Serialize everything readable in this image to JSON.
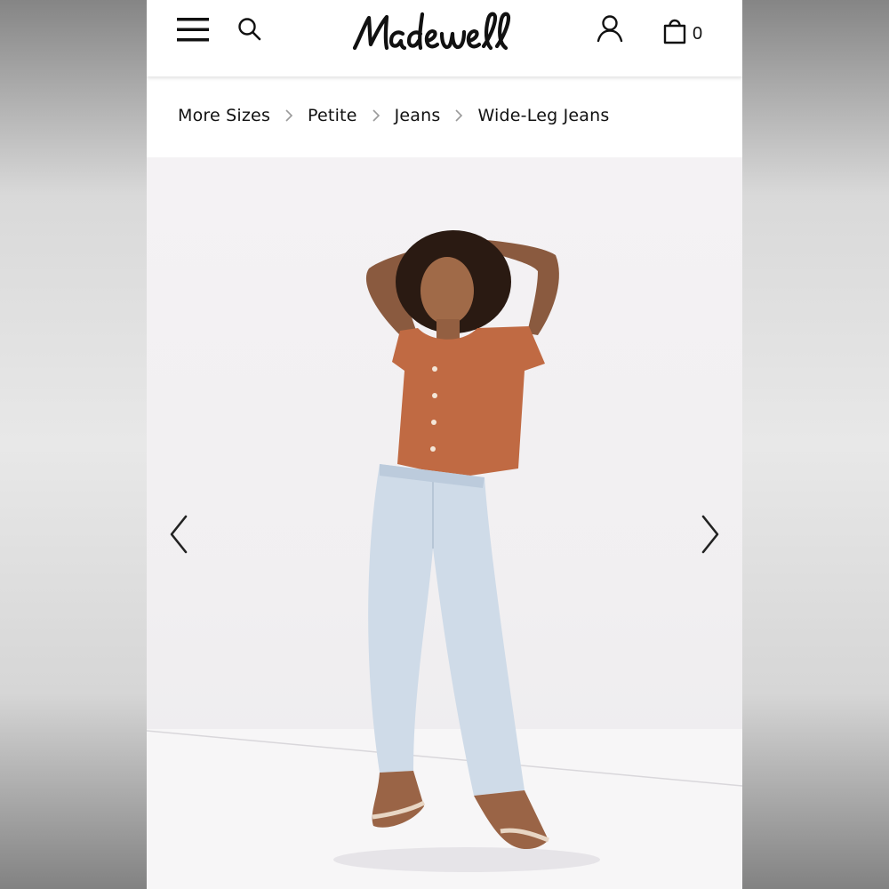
{
  "header": {
    "brand": "Madewell",
    "bag_count": "0",
    "icons": {
      "menu": "hamburger-menu-icon",
      "search": "search-icon",
      "account": "account-icon",
      "bag": "shopping-bag-icon"
    }
  },
  "breadcrumb": {
    "items": [
      "More Sizes",
      "Petite",
      "Jeans",
      "Wide-Leg Jeans"
    ],
    "separator_icon": "chevron-right-icon"
  },
  "gallery": {
    "prev_icon": "chevron-left-icon",
    "next_icon": "chevron-right-icon"
  },
  "colors": {
    "text": "#111111",
    "separator": "#9a9a9a",
    "top": "#c06a43",
    "jeans": "#cfdbe8"
  }
}
